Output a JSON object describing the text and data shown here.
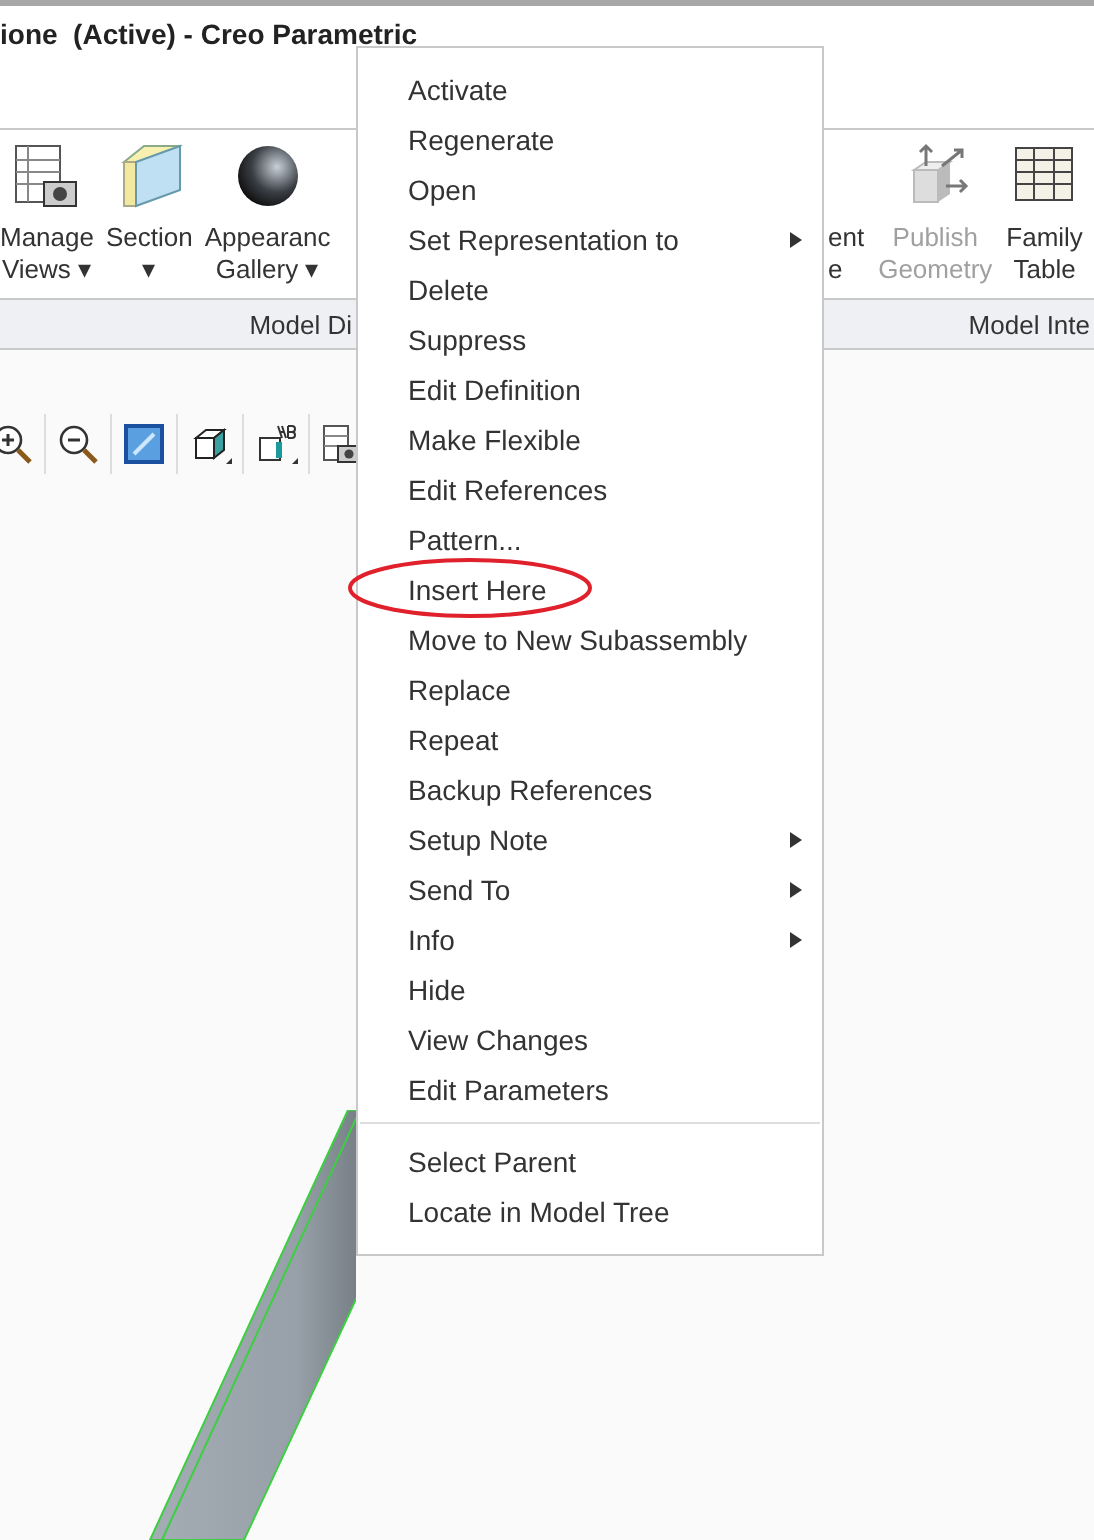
{
  "window": {
    "title": "ione  (Active) - Creo Parametric"
  },
  "ribbon": {
    "left_buttons": [
      {
        "lines": [
          "Manage",
          "Views ▾"
        ],
        "disabled": false
      },
      {
        "lines": [
          "Section",
          "▾"
        ],
        "disabled": false
      },
      {
        "lines": [
          "Appearanc",
          "Gallery ▾"
        ],
        "disabled": false
      }
    ],
    "right_buttons": [
      {
        "lines": [
          "ent",
          "e"
        ],
        "disabled": false
      },
      {
        "lines": [
          "Publish",
          "Geometry"
        ],
        "disabled": true
      },
      {
        "lines": [
          "Family",
          "Table"
        ],
        "disabled": false
      }
    ],
    "group_labels": [
      "Model Di",
      "Model Inte"
    ]
  },
  "context_menu": {
    "groups": [
      [
        {
          "label": "Activate",
          "submenu": false,
          "circled": false
        },
        {
          "label": "Regenerate",
          "submenu": false,
          "circled": false
        },
        {
          "label": "Open",
          "submenu": false,
          "circled": false
        },
        {
          "label": "Set Representation to",
          "submenu": true,
          "circled": false
        },
        {
          "label": "Delete",
          "submenu": false,
          "circled": false
        },
        {
          "label": "Suppress",
          "submenu": false,
          "circled": false
        },
        {
          "label": "Edit Definition",
          "submenu": false,
          "circled": false
        },
        {
          "label": "Make Flexible",
          "submenu": false,
          "circled": false
        },
        {
          "label": "Edit References",
          "submenu": false,
          "circled": false
        },
        {
          "label": "Pattern...",
          "submenu": false,
          "circled": false
        },
        {
          "label": "Insert Here",
          "submenu": false,
          "circled": true
        },
        {
          "label": "Move to New Subassembly",
          "submenu": false,
          "circled": false
        },
        {
          "label": "Replace",
          "submenu": false,
          "circled": false
        },
        {
          "label": "Repeat",
          "submenu": false,
          "circled": false
        },
        {
          "label": "Backup References",
          "submenu": false,
          "circled": false
        },
        {
          "label": "Setup Note",
          "submenu": true,
          "circled": false
        },
        {
          "label": "Send To",
          "submenu": true,
          "circled": false
        },
        {
          "label": "Info",
          "submenu": true,
          "circled": false
        },
        {
          "label": "Hide",
          "submenu": false,
          "circled": false
        },
        {
          "label": "View Changes",
          "submenu": false,
          "circled": false
        },
        {
          "label": "Edit Parameters",
          "submenu": false,
          "circled": false
        }
      ],
      [
        {
          "label": "Select Parent",
          "submenu": false,
          "circled": false
        },
        {
          "label": "Locate in Model Tree",
          "submenu": false,
          "circled": false
        }
      ]
    ]
  }
}
